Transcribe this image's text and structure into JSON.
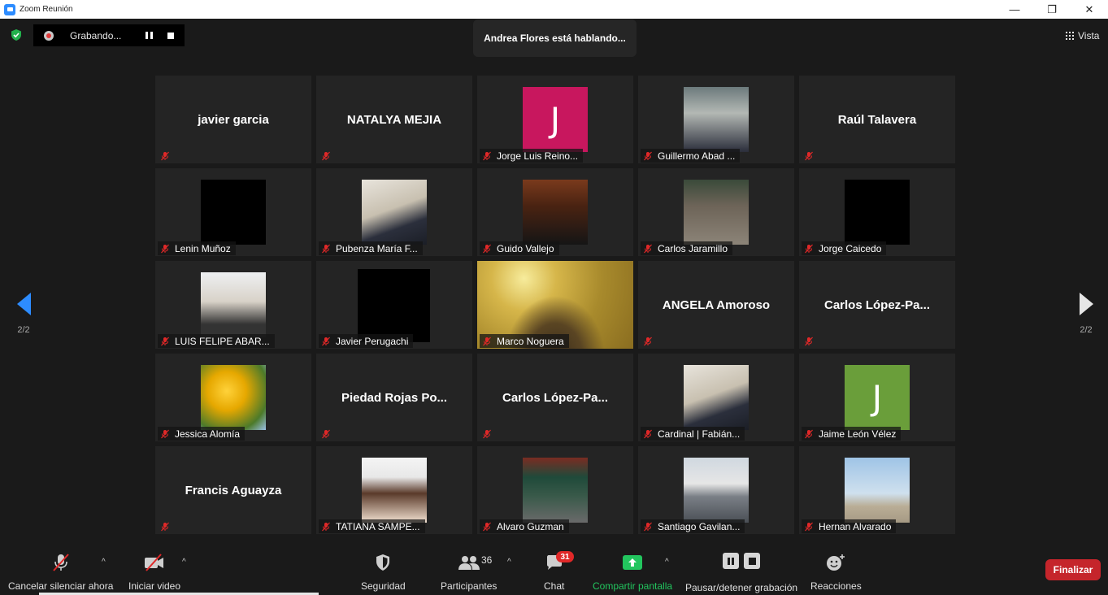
{
  "window": {
    "title": "Zoom Reunión",
    "minimize": "—",
    "restore": "❐",
    "close": "✕"
  },
  "recording": {
    "label": "Grabando..."
  },
  "speaker_banner": "Andrea Flores está hablando...",
  "view_button": "Vista",
  "pager": {
    "current": "2/2"
  },
  "participants": [
    {
      "name": "javier garcia",
      "kind": "name",
      "label": ""
    },
    {
      "name": "NATALYA MEJIA",
      "kind": "name",
      "label": ""
    },
    {
      "name": "Jorge Luis Reino...",
      "kind": "letter",
      "letter": "J",
      "color": "#c8175e",
      "label": "Jorge Luis Reino..."
    },
    {
      "name": "Guillermo Abad ...",
      "kind": "photo",
      "label": "Guillermo Abad ..."
    },
    {
      "name": "Raúl Talavera",
      "kind": "name",
      "label": ""
    },
    {
      "name": "Lenin Muñoz",
      "kind": "photo",
      "label": "Lenin Muñoz"
    },
    {
      "name": "Pubenza María F...",
      "kind": "photo",
      "label": "Pubenza María F..."
    },
    {
      "name": "Guido Vallejo",
      "kind": "photo",
      "label": "Guido Vallejo"
    },
    {
      "name": "Carlos Jaramillo",
      "kind": "photo",
      "label": "Carlos Jaramillo"
    },
    {
      "name": "Jorge Caicedo",
      "kind": "photo",
      "label": "Jorge Caicedo"
    },
    {
      "name": "LUIS FELIPE ABAR...",
      "kind": "photo",
      "label": "LUIS FELIPE ABAR..."
    },
    {
      "name": "Javier Perugachi",
      "kind": "photo",
      "label": "Javier Perugachi"
    },
    {
      "name": "Marco Noguera",
      "kind": "video",
      "label": "Marco Noguera"
    },
    {
      "name": "ANGELA Amoroso",
      "kind": "name",
      "label": ""
    },
    {
      "name": "Carlos  López-Pa...",
      "kind": "name",
      "label": ""
    },
    {
      "name": "Jessica Alomía",
      "kind": "photo",
      "label": "Jessica Alomía"
    },
    {
      "name": "Piedad  Rojas  Po...",
      "kind": "name",
      "label": ""
    },
    {
      "name": "Carlos  López-Pa...",
      "kind": "name",
      "label": ""
    },
    {
      "name": "Cardinal | Fabián...",
      "kind": "photo",
      "label": "Cardinal | Fabián..."
    },
    {
      "name": "Jaime León Vélez",
      "kind": "letter",
      "letter": "J",
      "color": "#6a9e3a",
      "label": "Jaime León Vélez"
    },
    {
      "name": "Francis Aguayza",
      "kind": "name",
      "label": ""
    },
    {
      "name": "TATIANA SAMPE...",
      "kind": "photo",
      "label": "TATIANA SAMPE..."
    },
    {
      "name": "Alvaro Guzman",
      "kind": "photo",
      "label": "Alvaro Guzman"
    },
    {
      "name": "Santiago Gavilan...",
      "kind": "photo",
      "label": "Santiago Gavilan..."
    },
    {
      "name": "Hernan Alvarado",
      "kind": "photo",
      "label": "Hernan Alvarado"
    }
  ],
  "toolbar": {
    "unmute": "Cancelar silenciar ahora",
    "start_video": "Iniciar video",
    "security": "Seguridad",
    "participants": "Participantes",
    "participants_count": "36",
    "chat": "Chat",
    "chat_badge": "31",
    "share": "Compartir pantalla",
    "pause_stop_recording": "Pausar/detener grabación",
    "reactions": "Reacciones",
    "end": "Finalizar"
  },
  "colors": {
    "accent": "#2d8cff",
    "share_green": "#22c55e",
    "end_red": "#c5252b",
    "badge_red": "#e02828"
  }
}
